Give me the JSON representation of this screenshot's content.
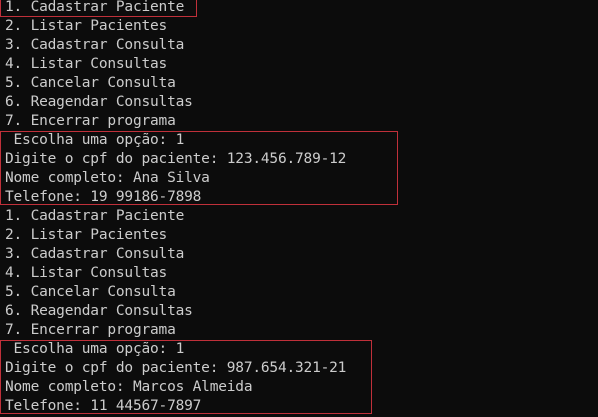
{
  "colors": {
    "background": "#0c0c0c",
    "text": "#cccccc",
    "highlight_border": "#c0303a"
  },
  "terminal": {
    "lines": [
      "1. Cadastrar Paciente",
      "2. Listar Pacientes",
      "3. Cadastrar Consulta",
      "4. Listar Consultas",
      "5. Cancelar Consulta",
      "6. Reagendar Consultas",
      "7. Encerrar programa",
      " Escolha uma opção: 1",
      "Digite o cpf do paciente: 123.456.789-12",
      "Nome completo: Ana Silva",
      "Telefone: 19 99186-7898",
      "1. Cadastrar Paciente",
      "2. Listar Pacientes",
      "3. Cadastrar Consulta",
      "4. Listar Consultas",
      "5. Cancelar Consulta",
      "6. Reagendar Consultas",
      "7. Encerrar programa",
      " Escolha uma opção: 1",
      "Digite o cpf do paciente: 987.654.321-21",
      "Nome completo: Marcos Almeida",
      "Telefone: 11 44567-7897"
    ]
  }
}
